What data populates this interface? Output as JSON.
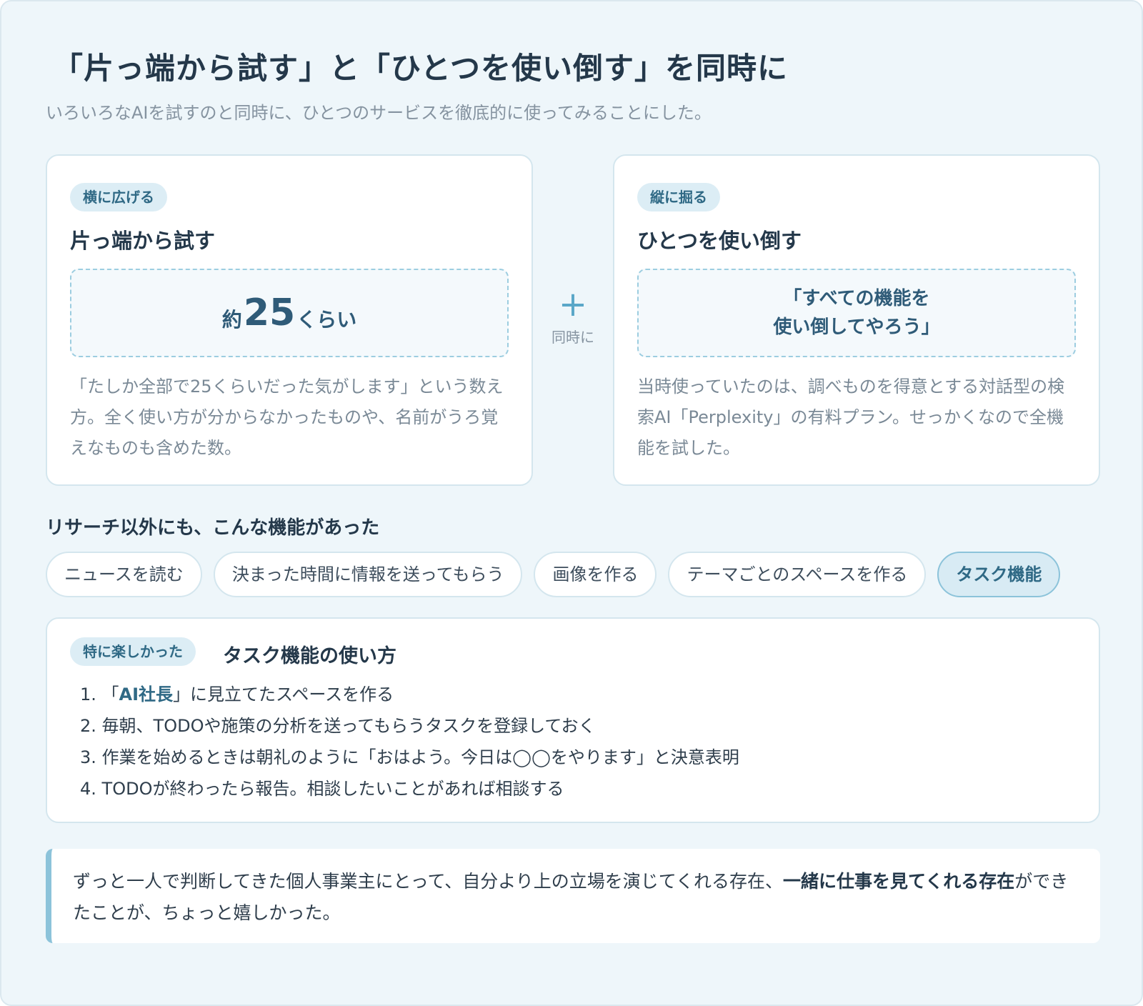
{
  "header": {
    "title": "「片っ端から試す」と「ひとつを使い倒す」を同時に",
    "subtitle": "いろいろなAIを試すのと同時に、ひとつのサービスを徹底的に使ってみることにした。"
  },
  "left_card": {
    "tag": "横に広げる",
    "title": "片っ端から試す",
    "count_prefix": "約",
    "count_number": "25",
    "count_suffix": "くらい",
    "body": "「たしか全部で25くらいだった気がします」という数え方。全く使い方が分からなかったものや、名前がうろ覚えなものも含めた数。"
  },
  "connector": {
    "icon": "plus-icon",
    "symbol": "+",
    "label": "同時に"
  },
  "right_card": {
    "tag": "縦に掘る",
    "title": "ひとつを使い倒す",
    "quote": "「すべての機能を\n使い倒してやろう」",
    "body": "当時使っていたのは、調べものを得意とする対話型の検索AI「Perplexity」の有料プラン。せっかくなので全機能を試した。"
  },
  "features": {
    "heading": "リサーチ以外にも、こんな機能があった",
    "chips": [
      {
        "label": "ニュースを読む",
        "active": false
      },
      {
        "label": "決まった時間に情報を送ってもらう",
        "active": false
      },
      {
        "label": "画像を作る",
        "active": false
      },
      {
        "label": "テーマごとのスペースを作る",
        "active": false
      },
      {
        "label": "タスク機能",
        "active": true
      }
    ]
  },
  "task_card": {
    "tag": "特に楽しかった",
    "title": "タスク機能の使い方",
    "steps": [
      {
        "num": "1.",
        "pre": "「",
        "bold": "AI社長",
        "post": "」に見立てたスペースを作る"
      },
      {
        "num": "2.",
        "text": "毎朝、TODOや施策の分析を送ってもらうタスクを登録しておく"
      },
      {
        "num": "3.",
        "text": "作業を始めるときは朝礼のように「おはよう。今日は◯◯をやります」と決意表明"
      },
      {
        "num": "4.",
        "text": "TODOが終わったら報告。相談したいことがあれば相談する"
      }
    ]
  },
  "closing": {
    "text_before": "ずっと一人で判断してきた個人事業主にとって、自分より上の立場を演じてくれる存在、",
    "text_bold": "一緒に仕事を見てくれる存在",
    "text_after": "ができたことが、ちょっと嬉しかった。"
  },
  "colors": {
    "background": "#eef6fa",
    "accent": "#5aa7c8",
    "tag_background": "#dcedf5",
    "tag_text": "#2f6985"
  }
}
